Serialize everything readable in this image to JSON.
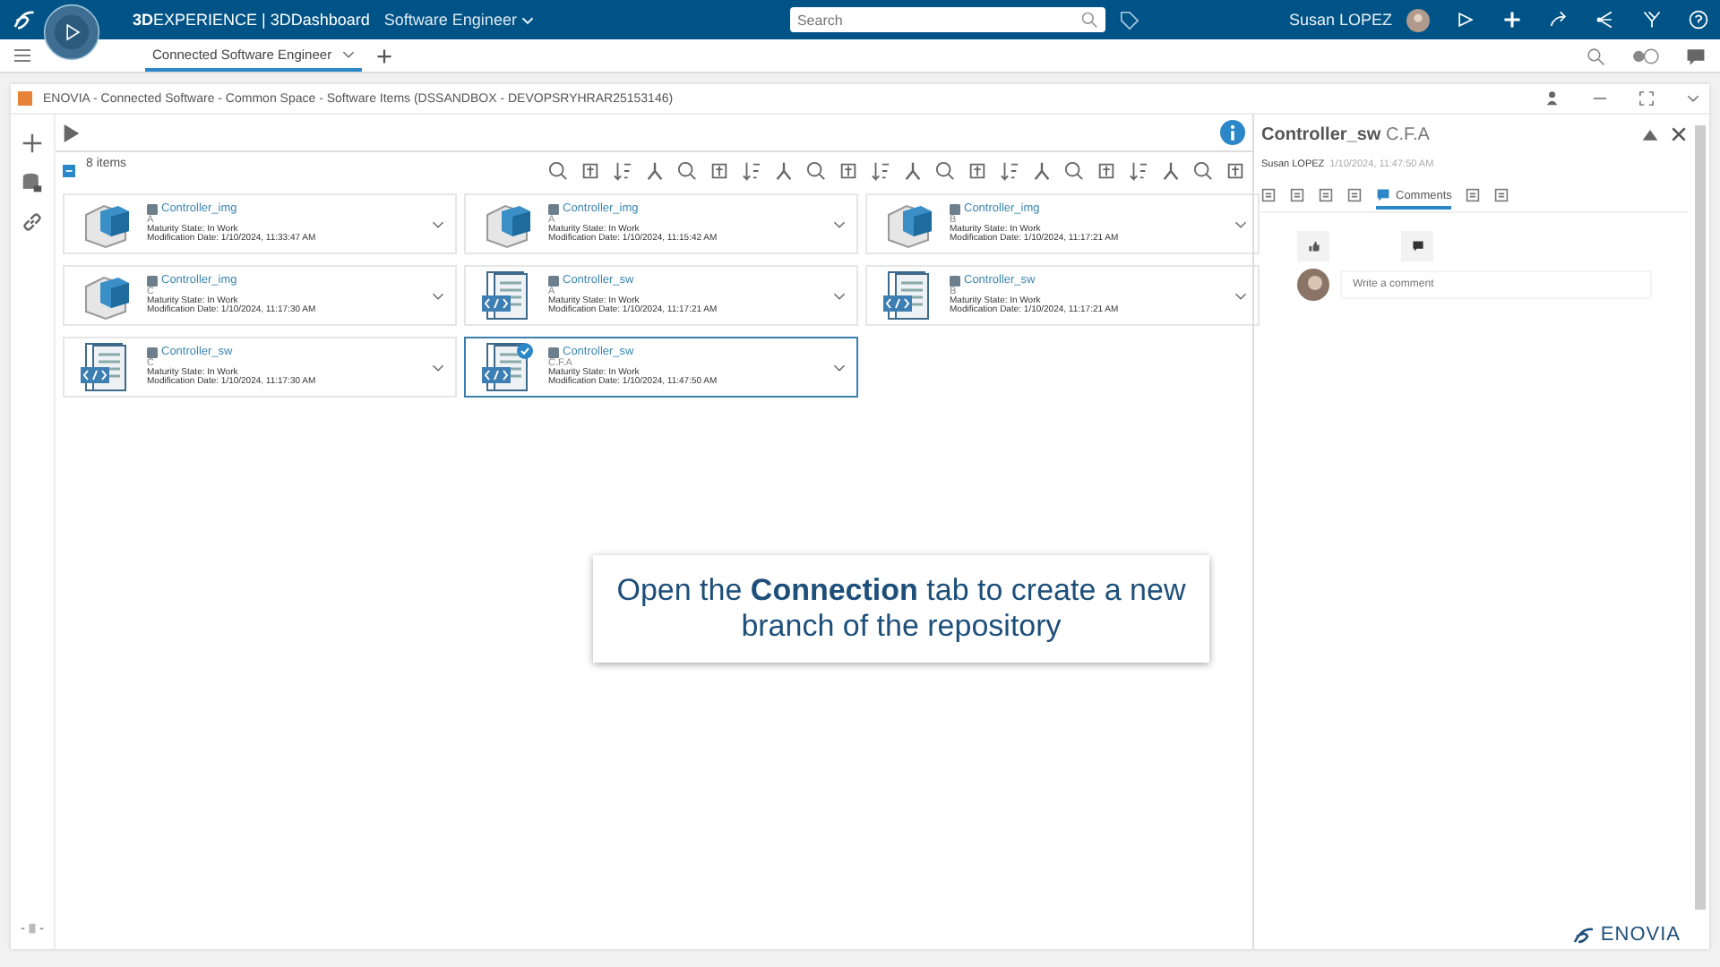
{
  "topbar": {
    "brand": "**3D**EXPERIENCE | 3DDashboard",
    "role": "Software Engineer",
    "search": {
      "placeholder": "Search"
    },
    "user": "Susan LOPEZ"
  },
  "dashboard_tabs": [
    {
      "label": "Connected Software Engineer",
      "selected": true
    }
  ],
  "panel": {
    "title": "ENOVIA - Connected Software - Common Space - Software Items (DSSANDBOX - DEVOPSRYHRAR25153146)"
  },
  "items_count": "8 items",
  "items": [
    {
      "kind": "img",
      "title": "Controller_img",
      "revision": "A",
      "maturity": "Maturity State: In Work",
      "date": "Modification Date: 1/10/2024, 11:33:47 AM",
      "selected": false
    },
    {
      "kind": "img",
      "title": "Controller_img",
      "revision": "A",
      "maturity": "Maturity State: In Work",
      "date": "Modification Date: 1/10/2024, 11:15:42 AM",
      "selected": false
    },
    {
      "kind": "img",
      "title": "Controller_img",
      "revision": "B",
      "maturity": "Maturity State: In Work",
      "date": "Modification Date: 1/10/2024, 11:17:21 AM",
      "selected": false
    },
    {
      "kind": "img",
      "title": "Controller_img",
      "revision": "C",
      "maturity": "Maturity State: In Work",
      "date": "Modification Date: 1/10/2024, 11:17:30 AM",
      "selected": false
    },
    {
      "kind": "sw",
      "title": "Controller_sw",
      "revision": "A",
      "maturity": "Maturity State: In Work",
      "date": "Modification Date: 1/10/2024, 11:17:21 AM",
      "selected": false
    },
    {
      "kind": "sw",
      "title": "Controller_sw",
      "revision": "B",
      "maturity": "Maturity State: In Work",
      "date": "Modification Date: 1/10/2024, 11:17:21 AM",
      "selected": false
    },
    {
      "kind": "sw",
      "title": "Controller_sw",
      "revision": "C",
      "maturity": "Maturity State: In Work",
      "date": "Modification Date: 1/10/2024, 11:17:30 AM",
      "selected": false
    },
    {
      "kind": "sw",
      "title": "Controller_sw",
      "revision": "C.F.A",
      "maturity": "Maturity State: In Work",
      "date": "Modification Date: 1/10/2024, 11:47:50 AM",
      "selected": true
    }
  ],
  "details": {
    "title": "**Controller_sw** C.F.A",
    "author": "Susan LOPEZ",
    "date": "1/10/2024, 11:47:50 AM",
    "tabs": [
      {
        "kind": "icon",
        "selected": false
      },
      {
        "kind": "icon",
        "selected": false
      },
      {
        "kind": "icon",
        "selected": false
      },
      {
        "kind": "icon",
        "selected": false
      },
      {
        "kind": "label",
        "label": "Comments",
        "selected": true
      },
      {
        "kind": "icon",
        "selected": false
      },
      {
        "kind": "icon",
        "selected": false
      }
    ],
    "comment": {
      "placeholder": "Write a comment"
    }
  },
  "callout": "Open the **Connection** tab to create a new branch of the repository",
  "footer_logo": "ENOVIA"
}
